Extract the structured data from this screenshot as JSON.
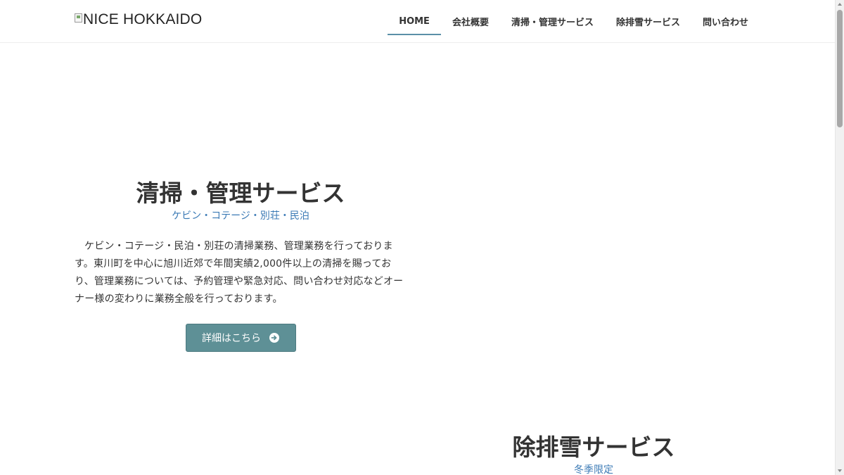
{
  "header": {
    "logo_text": "NICE HOKKAIDO",
    "nav": [
      {
        "label": "HOME",
        "active": true
      },
      {
        "label": "会社概要",
        "active": false
      },
      {
        "label": "清掃・管理サービス",
        "active": false
      },
      {
        "label": "除排雪サービス",
        "active": false
      },
      {
        "label": "問い合わせ",
        "active": false
      }
    ]
  },
  "cleaning": {
    "title": "清掃・管理サービス",
    "subtitle": "ケビン・コテージ・別荘・民泊",
    "body": "ケビン・コテージ・民泊・別荘の清掃業務、管理業務を行っております。東川町を中心に旭川近郊で年間実績2,000件以上の清掃を賜っており、管理業務については、予約管理や緊急対応、問い合わせ対応などオーナー様の変わりに業務全般を行っております。",
    "button_label": "詳細はこちら"
  },
  "snow": {
    "title": "除排雪サービス",
    "subtitle": "冬季限定"
  },
  "colors": {
    "accent": "#5b8fa8",
    "subtitle": "#3b7ab5",
    "button": "#5e9096"
  }
}
